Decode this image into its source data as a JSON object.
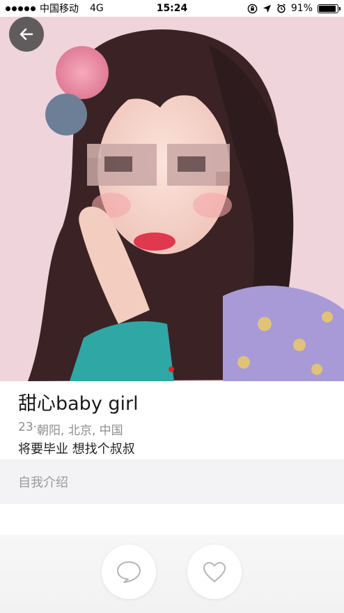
{
  "status_bar": {
    "carrier": "中国移动",
    "network": "4G",
    "time": "15:24",
    "battery": "91%",
    "battery_level": 0.91
  },
  "profile": {
    "name": "甜心baby girl",
    "age": "23",
    "separator": " · ",
    "location": "朝阳, 北京, 中国",
    "bio": "将要毕业 想找个叔叔"
  },
  "sections": {
    "intro_label": "自我介绍"
  },
  "icons": {
    "back": "arrow-left-icon",
    "chat": "chat-bubble-icon",
    "like": "heart-icon",
    "lock_rotation": "rotation-lock-icon",
    "location": "location-arrow-icon",
    "alarm": "alarm-icon"
  },
  "colors": {
    "background": "#ffffff",
    "section_bg": "#f3f3f5",
    "meta_text": "#8e8e8e",
    "icon_gray": "#b5b5b5"
  }
}
